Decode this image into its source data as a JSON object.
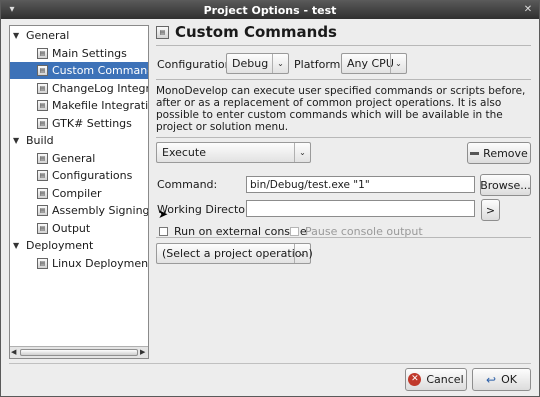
{
  "window": {
    "title": "Project Options - test"
  },
  "tree": {
    "items": [
      {
        "label": "General",
        "level": 0,
        "expander": "▼",
        "icon": "none"
      },
      {
        "label": "Main Settings",
        "level": 1,
        "icon": "settings-page-icon"
      },
      {
        "label": "Custom Commands",
        "level": 1,
        "icon": "settings-page-icon",
        "selected": true
      },
      {
        "label": "ChangeLog Integration",
        "level": 1,
        "icon": "settings-page-icon"
      },
      {
        "label": "Makefile Integration",
        "level": 1,
        "icon": "settings-page-icon"
      },
      {
        "label": "GTK# Settings",
        "level": 1,
        "icon": "settings-page-icon"
      },
      {
        "label": "Build",
        "level": 0,
        "expander": "▼",
        "icon": "none"
      },
      {
        "label": "General",
        "level": 1,
        "icon": "settings-page-icon"
      },
      {
        "label": "Configurations",
        "level": 1,
        "icon": "settings-page-icon"
      },
      {
        "label": "Compiler",
        "level": 1,
        "icon": "settings-page-icon"
      },
      {
        "label": "Assembly Signing",
        "level": 1,
        "icon": "settings-page-icon"
      },
      {
        "label": "Output",
        "level": 1,
        "icon": "settings-page-icon"
      },
      {
        "label": "Deployment",
        "level": 0,
        "expander": "▼",
        "icon": "none"
      },
      {
        "label": "Linux Deployment Settings",
        "level": 1,
        "icon": "settings-page-icon"
      }
    ]
  },
  "panel": {
    "title": "Custom Commands",
    "configuration_label": "Configuration:",
    "configuration_value": "Debug",
    "platform_label": "Platform:",
    "platform_value": "Any CPU",
    "description": "MonoDevelop can execute user specified commands or scripts before, after or as a replacement of common project operations. It is also possible to enter custom commands which will be available in the project or solution menu.",
    "operation_value": "Execute",
    "remove_label": "Remove",
    "command_label": "Command:",
    "command_value": "bin/Debug/test.exe \"1\"",
    "browse_label": "Browse...",
    "working_dir_label": "Working Directory:",
    "working_dir_value": "",
    "working_dir_button": ">",
    "run_external_label": "Run on external console",
    "pause_output_label": "Pause console output",
    "select_operation_value": "(Select a project operation)"
  },
  "footer": {
    "cancel_label": "Cancel",
    "ok_label": "OK"
  },
  "colors": {
    "selection": "#3d72b8",
    "cancel_icon": "#c0392b",
    "ok_icon": "#2b5fa8"
  }
}
